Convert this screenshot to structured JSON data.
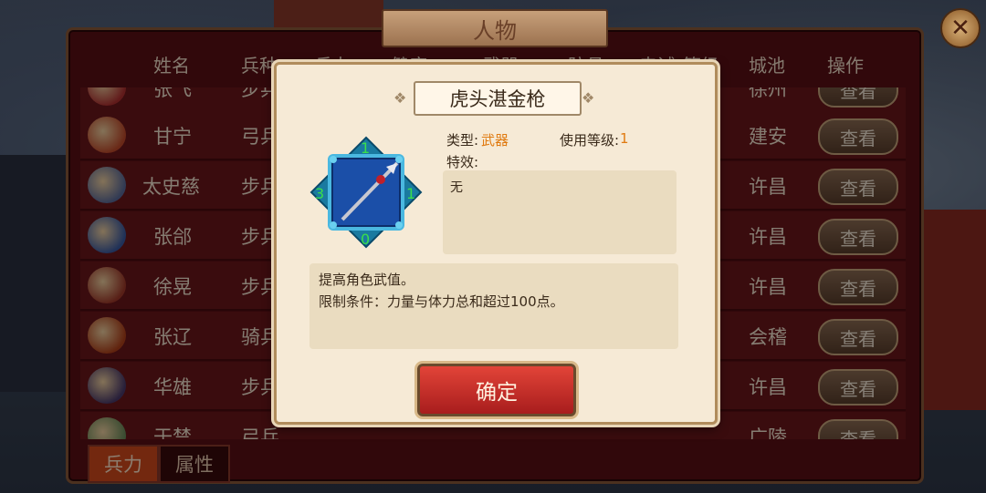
{
  "window": {
    "title": "人物"
  },
  "columns": [
    "姓名",
    "兵种",
    "兵力",
    "健康",
    "武器",
    "防具",
    "忠诚",
    "等级",
    "城池",
    "操作"
  ],
  "rows": [
    {
      "name": "张飞",
      "type": "步兵",
      "city": "徐州",
      "action": "查看",
      "avatar_color": "#b03030"
    },
    {
      "name": "甘宁",
      "type": "弓兵",
      "city": "建安",
      "action": "查看",
      "avatar_color": "#c04a2a"
    },
    {
      "name": "太史慈",
      "type": "步兵",
      "city": "许昌",
      "action": "查看",
      "avatar_color": "#5a6a9a"
    },
    {
      "name": "张郃",
      "type": "步兵",
      "city": "许昌",
      "action": "查看",
      "avatar_color": "#3a5aa0"
    },
    {
      "name": "徐晃",
      "type": "步兵",
      "city": "许昌",
      "action": "查看",
      "avatar_color": "#a03a2a"
    },
    {
      "name": "张辽",
      "type": "骑兵",
      "city": "会稽",
      "action": "查看",
      "avatar_color": "#b0401a"
    },
    {
      "name": "华雄",
      "type": "步兵",
      "city": "许昌",
      "action": "查看",
      "avatar_color": "#4a3a6a"
    },
    {
      "name": "于禁",
      "type": "弓兵",
      "city": "广陵",
      "action": "查看",
      "avatar_color": "#6a8a5a"
    }
  ],
  "tabs": [
    {
      "label": "兵力",
      "active": true
    },
    {
      "label": "属性",
      "active": false
    }
  ],
  "dialog": {
    "title": "虎头湛金枪",
    "type_label": "类型:",
    "type_value": "武器",
    "level_label": "使用等级:",
    "level_value": "1",
    "effect_label": "特效:",
    "effect_value": "无",
    "stats": {
      "top": "1",
      "right": "1",
      "bottom": "0",
      "left": "3"
    },
    "description_line1": "提高角色武值。",
    "description_line2": "限制条件：力量与体力总和超过100点。",
    "confirm_label": "确定"
  },
  "colors": {
    "accent_orange": "#e07a10",
    "panel_red": "#5a0f14",
    "confirm_red": "#d2352c"
  }
}
